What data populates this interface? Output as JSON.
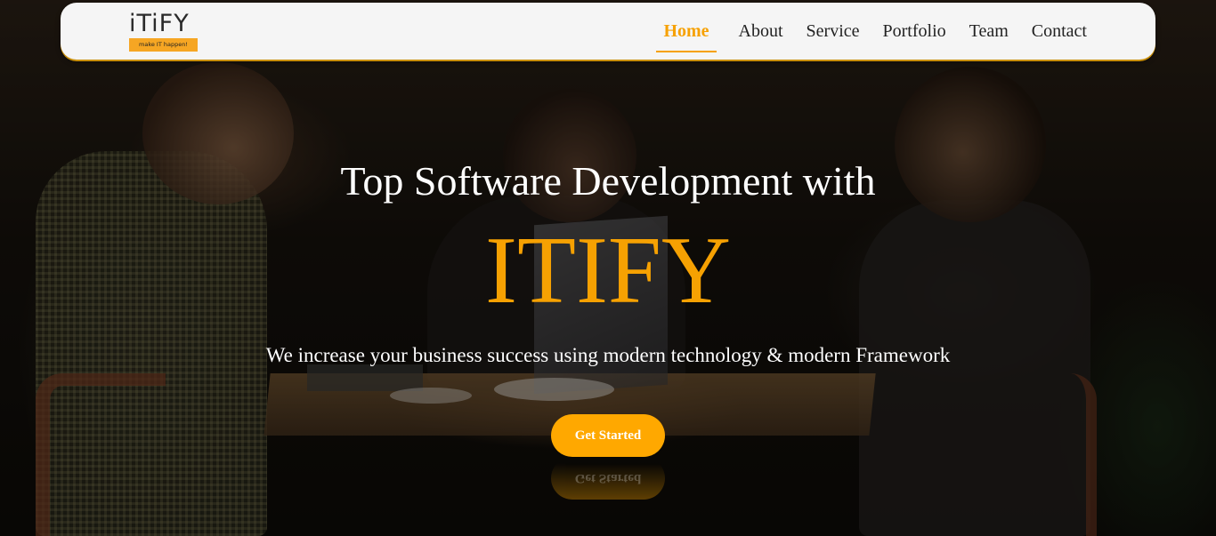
{
  "navbar": {
    "logo": {
      "wordmark": "iTiFY",
      "tagline": "make IT happen!"
    },
    "links": [
      {
        "label": "Home",
        "active": true
      },
      {
        "label": "About",
        "active": false
      },
      {
        "label": "Service",
        "active": false
      },
      {
        "label": "Portfolio",
        "active": false
      },
      {
        "label": "Team",
        "active": false
      },
      {
        "label": "Contact",
        "active": false
      }
    ]
  },
  "hero": {
    "title": "Top Software Development with",
    "brand": "ITIFY",
    "subtitle": "We increase your business success using modern technology & modern Framework",
    "cta_label": "Get Started",
    "background": "photo-of-people-working-at-cafe-table"
  },
  "colors": {
    "accent": "#f6a102",
    "button": "#ffa800",
    "navbar_bg": "#f5f5f5",
    "text_light": "#ffffff"
  }
}
